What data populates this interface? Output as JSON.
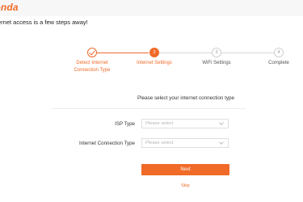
{
  "header": {
    "logo_text": "enda",
    "subtitle": "ernet access is a few steps away!"
  },
  "steps": [
    {
      "number": "",
      "icon": "check-icon",
      "label_line1": "Detect Internet",
      "label_line2": "Connection Type",
      "state": "done"
    },
    {
      "number": "2",
      "label_line1": "Internet Settings",
      "label_line2": "",
      "state": "current"
    },
    {
      "number": "3",
      "label_line1": "WiFi Settings",
      "label_line2": "",
      "state": "todo"
    },
    {
      "number": "4",
      "label_line1": "Complete",
      "label_line2": "",
      "state": "todo"
    }
  ],
  "form": {
    "prompt": "Please select your internet connection type",
    "isp_type": {
      "label": "ISP Type",
      "placeholder": "Please select"
    },
    "connection_type": {
      "label": "Internet Connection Type",
      "placeholder": "Please select"
    },
    "next_label": "Next",
    "skip_label": "Skip"
  },
  "colors": {
    "accent": "#f06a28",
    "inactive": "#dadada"
  }
}
